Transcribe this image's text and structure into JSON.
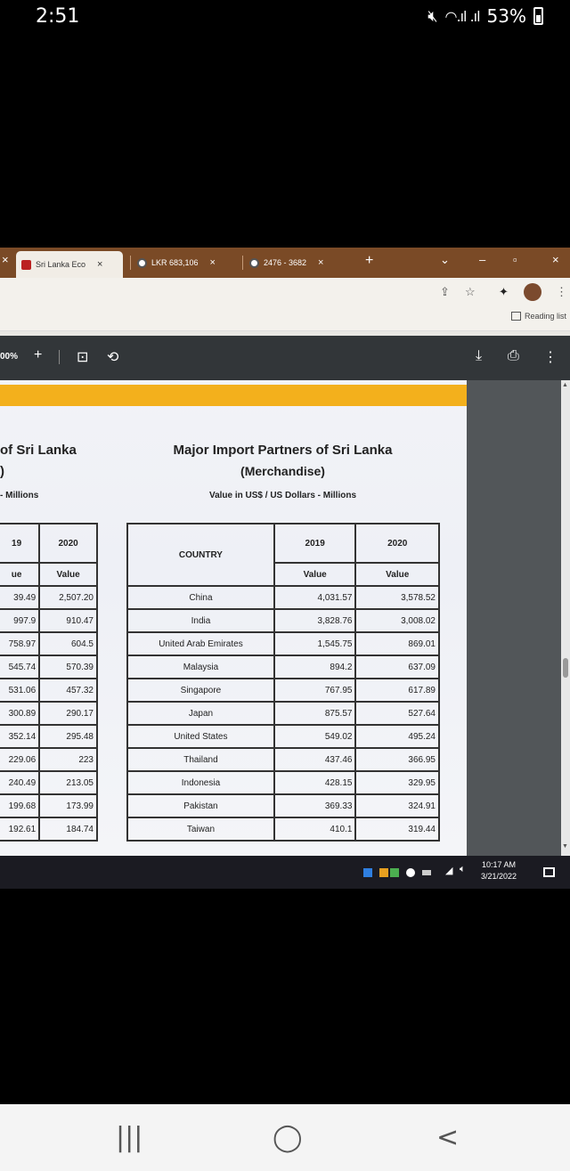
{
  "status_bar": {
    "time": "2:51",
    "battery": "53%"
  },
  "browser": {
    "tabs": [
      {
        "label": "Sri Lanka Eco",
        "close": "×"
      },
      {
        "label": "LKR 683,106",
        "close": "×"
      },
      {
        "label": "2476 - 3682",
        "close": "×"
      }
    ],
    "new_tab": "+",
    "window_controls": [
      "⌄",
      "–",
      "▫",
      "×"
    ],
    "reading_list": "Reading list"
  },
  "pdf_toolbar": {
    "zoom": "00%",
    "plus": "+"
  },
  "left_table": {
    "heading_line1": "of Sri Lanka",
    "heading_line2": ")",
    "unit": "- Millions",
    "col_2019": "19",
    "col_2020": "2020",
    "sub_2019": "ue",
    "sub_2020": "Value",
    "rows": [
      [
        "39.49",
        "2,507.20"
      ],
      [
        "997.9",
        "910.47"
      ],
      [
        "758.97",
        "604.5"
      ],
      [
        "545.74",
        "570.39"
      ],
      [
        "531.06",
        "457.32"
      ],
      [
        "300.89",
        "290.17"
      ],
      [
        "352.14",
        "295.48"
      ],
      [
        "229.06",
        "223"
      ],
      [
        "240.49",
        "213.05"
      ],
      [
        "199.68",
        "173.99"
      ],
      [
        "192.61",
        "184.74"
      ]
    ]
  },
  "right_table": {
    "title": "Major Import Partners of Sri Lanka",
    "subtitle": "(Merchandise)",
    "unit": "Value in US$ / US Dollars - Millions",
    "col_country": "COUNTRY",
    "col_2019": "2019",
    "col_2020": "2020",
    "sub_2019": "Value",
    "sub_2020": "Value",
    "rows": [
      [
        "China",
        "4,031.57",
        "3,578.52"
      ],
      [
        "India",
        "3,828.76",
        "3,008.02"
      ],
      [
        "United Arab Emirates",
        "1,545.75",
        "869.01"
      ],
      [
        "Malaysia",
        "894.2",
        "637.09"
      ],
      [
        "Singapore",
        "767.95",
        "617.89"
      ],
      [
        "Japan",
        "875.57",
        "527.64"
      ],
      [
        "United States",
        "549.02",
        "495.24"
      ],
      [
        "Thailand",
        "437.46",
        "366.95"
      ],
      [
        "Indonesia",
        "428.15",
        "329.95"
      ],
      [
        "Pakistan",
        "369.33",
        "324.91"
      ],
      [
        "Taiwan",
        "410.1",
        "319.44"
      ]
    ]
  },
  "taskbar": {
    "time": "10:17 AM",
    "date": "3/21/2022"
  },
  "colors": {
    "tabstrip": "#7a4a26",
    "page_band": "#f3b01c",
    "pdf_toolbar": "#323639",
    "taskbar": "#1b1b22"
  }
}
